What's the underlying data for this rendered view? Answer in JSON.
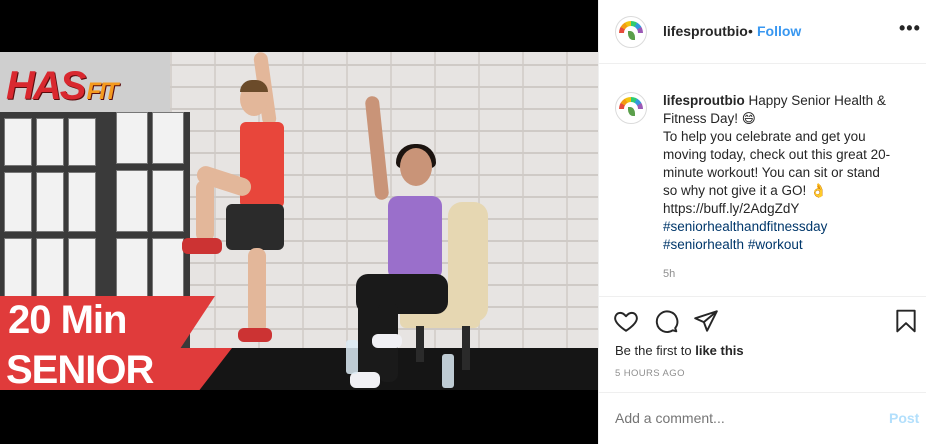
{
  "post": {
    "username": "lifesproutbio",
    "dot": "•",
    "follow_label": "Follow",
    "more_label": "•••",
    "caption_lines": [
      "Happy Senior Health &",
      "Fitness Day! 😄",
      "To help you celebrate and get you",
      "moving today, check out this great 20-",
      "minute workout! You can sit or stand",
      "so why not give it a GO! 👌",
      "https://buff.ly/2AdgZdY"
    ],
    "hashtags_line1": "#seniorhealthandfitnessday",
    "hashtags_line2a": "#seniorhealth",
    "hashtags_line2b": "#workout",
    "age": "5h",
    "likes_prefix": "Be the first to",
    "likes_link": "like this",
    "timestamp": "5 HOURS AGO",
    "comment_placeholder": "Add a comment...",
    "post_label": "Post"
  },
  "media": {
    "logo_main": "HAS",
    "logo_fit": "FIT",
    "overlay_line1": "20 Min",
    "overlay_line2": "SENIOR"
  },
  "icons": [
    "heart-icon",
    "comment-icon",
    "share-icon",
    "bookmark-icon",
    "more-icon"
  ],
  "colors": {
    "link_blue": "#3897f0",
    "hashtag": "#00376b",
    "banner_red": "#e03b3b",
    "post_disabled": "#b2dffc"
  }
}
